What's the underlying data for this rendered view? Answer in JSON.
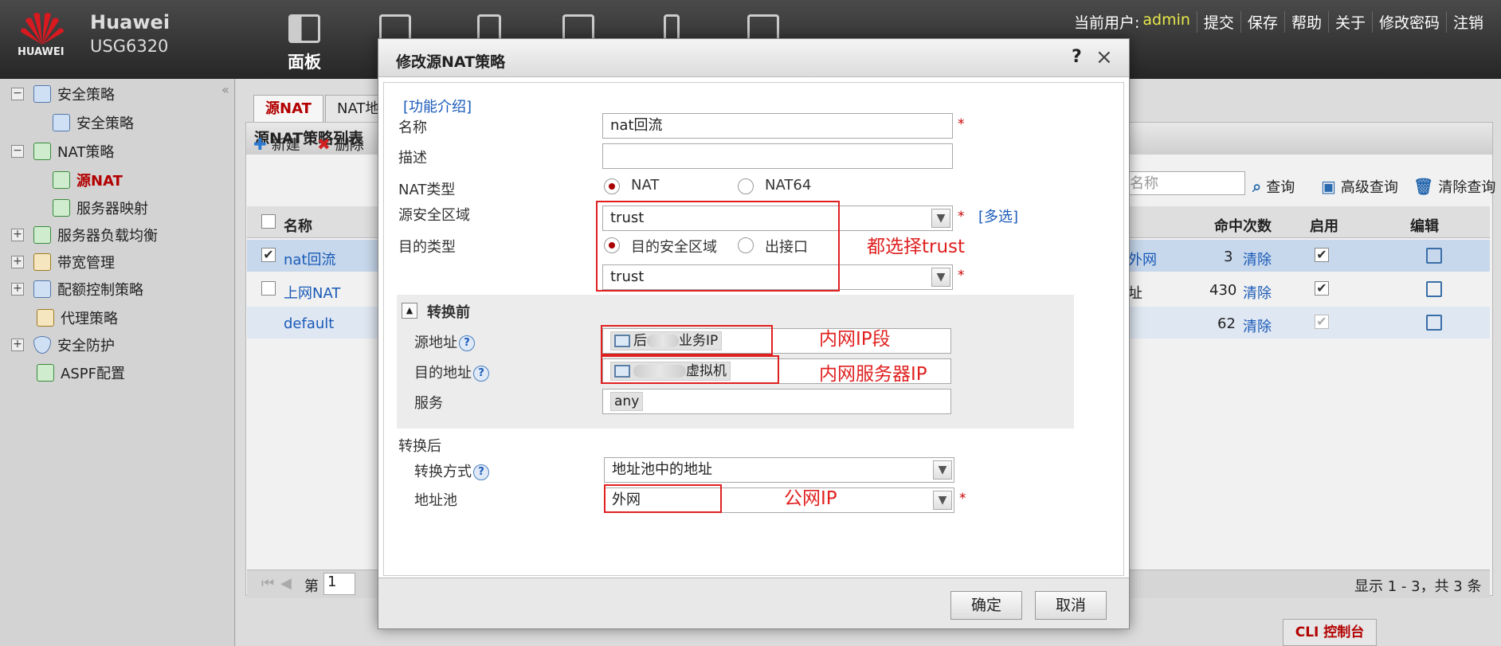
{
  "header": {
    "brand": "HUAWEI",
    "device_name": "Huawei",
    "device_model": "USG6320",
    "nav": [
      {
        "label": "面板"
      }
    ],
    "user_label": "当前用户:",
    "user_name": "admin",
    "actions": [
      "提交",
      "保存",
      "帮助",
      "关于",
      "修改密码",
      "注销"
    ]
  },
  "sidebar": {
    "items": [
      {
        "label": "安全策略",
        "expander": "−"
      },
      {
        "label": "安全策略"
      },
      {
        "label": "NAT策略",
        "expander": "−"
      },
      {
        "label": "源NAT"
      },
      {
        "label": "服务器映射"
      },
      {
        "label": "服务器负载均衡",
        "expander": "+"
      },
      {
        "label": "带宽管理",
        "expander": "+"
      },
      {
        "label": "配额控制策略",
        "expander": "+"
      },
      {
        "label": "代理策略"
      },
      {
        "label": "安全防护",
        "expander": "+"
      },
      {
        "label": "ASPF配置"
      }
    ],
    "collapse": "«"
  },
  "tabs": [
    {
      "label": "源NAT"
    },
    {
      "label": "NAT地"
    }
  ],
  "panel": {
    "title": "源NAT策略列表",
    "new": "新建",
    "delete": "删除",
    "search_placeholder": "名称",
    "search": "查询",
    "advanced": "高级查询",
    "clear": "清除查询"
  },
  "table": {
    "headers": [
      "名称",
      "命中次数",
      "启用",
      "编辑"
    ],
    "rows": [
      {
        "name": "nat回流",
        "zone": "外网",
        "hits": "3",
        "clear": "清除"
      },
      {
        "name": "上网NAT",
        "zone": "址",
        "hits": "430",
        "clear": "清除"
      },
      {
        "name": "default",
        "hits": "62",
        "clear": "清除"
      }
    ]
  },
  "pager": {
    "page_label": "第",
    "page_value": "1",
    "summary": "显示 1 - 3，共 3 条"
  },
  "cli": "CLI 控制台",
  "dialog": {
    "title": "修改源NAT策略",
    "help": "?",
    "close": "×",
    "intro": "[功能介绍]",
    "name_label": "名称",
    "name_value": "nat回流",
    "desc_label": "描述",
    "desc_value": "",
    "nat_type_label": "NAT类型",
    "nat_opt1": "NAT",
    "nat_opt2": "NAT64",
    "src_zone_label": "源安全区域",
    "src_zone_value": "trust",
    "multi": "[多选]",
    "dst_type_label": "目的类型",
    "dst_opt1": "目的安全区域",
    "dst_opt2": "出接口",
    "dst_zone_value": "trust",
    "before_label": "转换前",
    "before_toggle": "▲",
    "src_addr_label": "源地址",
    "src_addr_pre": "后",
    "src_addr_post": "业务IP",
    "dst_addr_label": "目的地址",
    "dst_addr_post": "虚拟机",
    "service_label": "服务",
    "service_value": "any",
    "after_label": "转换后",
    "mode_label": "转换方式",
    "mode_value": "地址池中的地址",
    "pool_label": "地址池",
    "pool_value": "外网",
    "ok": "确定",
    "cancel": "取消",
    "asterisk": "*"
  },
  "annotations": [
    "都选择trust",
    "内网IP段",
    "内网服务器IP",
    "公网IP"
  ],
  "colors": {
    "annotation": "#e02020",
    "active": "#b30000",
    "link": "#1a5ab8"
  }
}
